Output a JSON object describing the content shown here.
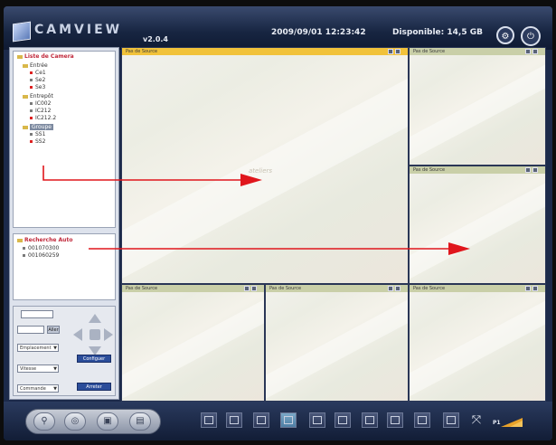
{
  "app": {
    "name": "CAMVIEW",
    "version": "v2.0.4",
    "datetime": "2009/09/01 12:23:42",
    "disk_available": "Disponible: 14,5 GB"
  },
  "tree": {
    "title": "Liste de Camera",
    "groups": [
      {
        "name": "Entrée",
        "cams": [
          "Ce1",
          "Se2",
          "Se3"
        ]
      },
      {
        "name": "Entrepôt",
        "cams": [
          "IC002",
          "IC212",
          "IC212.2"
        ]
      },
      {
        "name": "Groupe",
        "cams": [
          "SS1",
          "SS2"
        ]
      }
    ]
  },
  "recherche": {
    "title": "Recherche Auto",
    "items": [
      "001070300",
      "001060259"
    ]
  },
  "ptz": {
    "go_label": "Aller",
    "preset_select": "Emplacement",
    "speed_select": "Vitesse",
    "mode_select": "Commande",
    "btn_record": "Configuer",
    "btn_stop": "Arreter"
  },
  "tiles": {
    "label": "Pas de Source",
    "watermark": "ateliers"
  },
  "bottom": {
    "page_label": "P1"
  },
  "colors": {
    "active_bar": "#f1c23a",
    "arrow_red": "#e0161c",
    "tree_title": "#c0283a"
  }
}
